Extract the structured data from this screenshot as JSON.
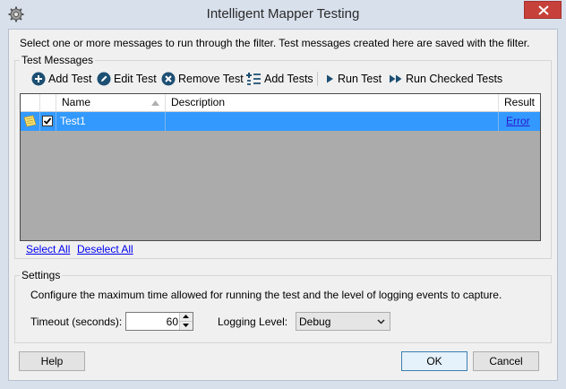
{
  "window": {
    "title": "Intelligent Mapper Testing",
    "icon": "gear-icon"
  },
  "instructions": "Select one or more messages to run through the filter. Test messages created here are saved with the filter.",
  "test_messages": {
    "legend": "Test Messages",
    "toolbar": {
      "add_test": "Add Test",
      "edit_test": "Edit Test",
      "remove_test": "Remove Test",
      "add_tests": "Add Tests",
      "run_test": "Run Test",
      "run_checked_tests": "Run Checked Tests"
    },
    "columns": {
      "name": "Name",
      "description": "Description",
      "result": "Result"
    },
    "rows": [
      {
        "checked": true,
        "name": "Test1",
        "description": "",
        "result": "Error",
        "selected": true
      }
    ],
    "select_all": "Select All",
    "deselect_all": "Deselect All"
  },
  "settings": {
    "legend": "Settings",
    "description": "Configure the maximum time allowed for running the test and the level of logging events to capture.",
    "timeout_label": "Timeout (seconds):",
    "timeout_value": "60",
    "logging_label": "Logging Level:",
    "logging_value": "Debug"
  },
  "buttons": {
    "help": "Help",
    "ok": "OK",
    "cancel": "Cancel"
  },
  "colors": {
    "selection": "#3399ff",
    "link": "#0000ee",
    "close": "#c7413b",
    "frame": "#d8e0ec"
  }
}
